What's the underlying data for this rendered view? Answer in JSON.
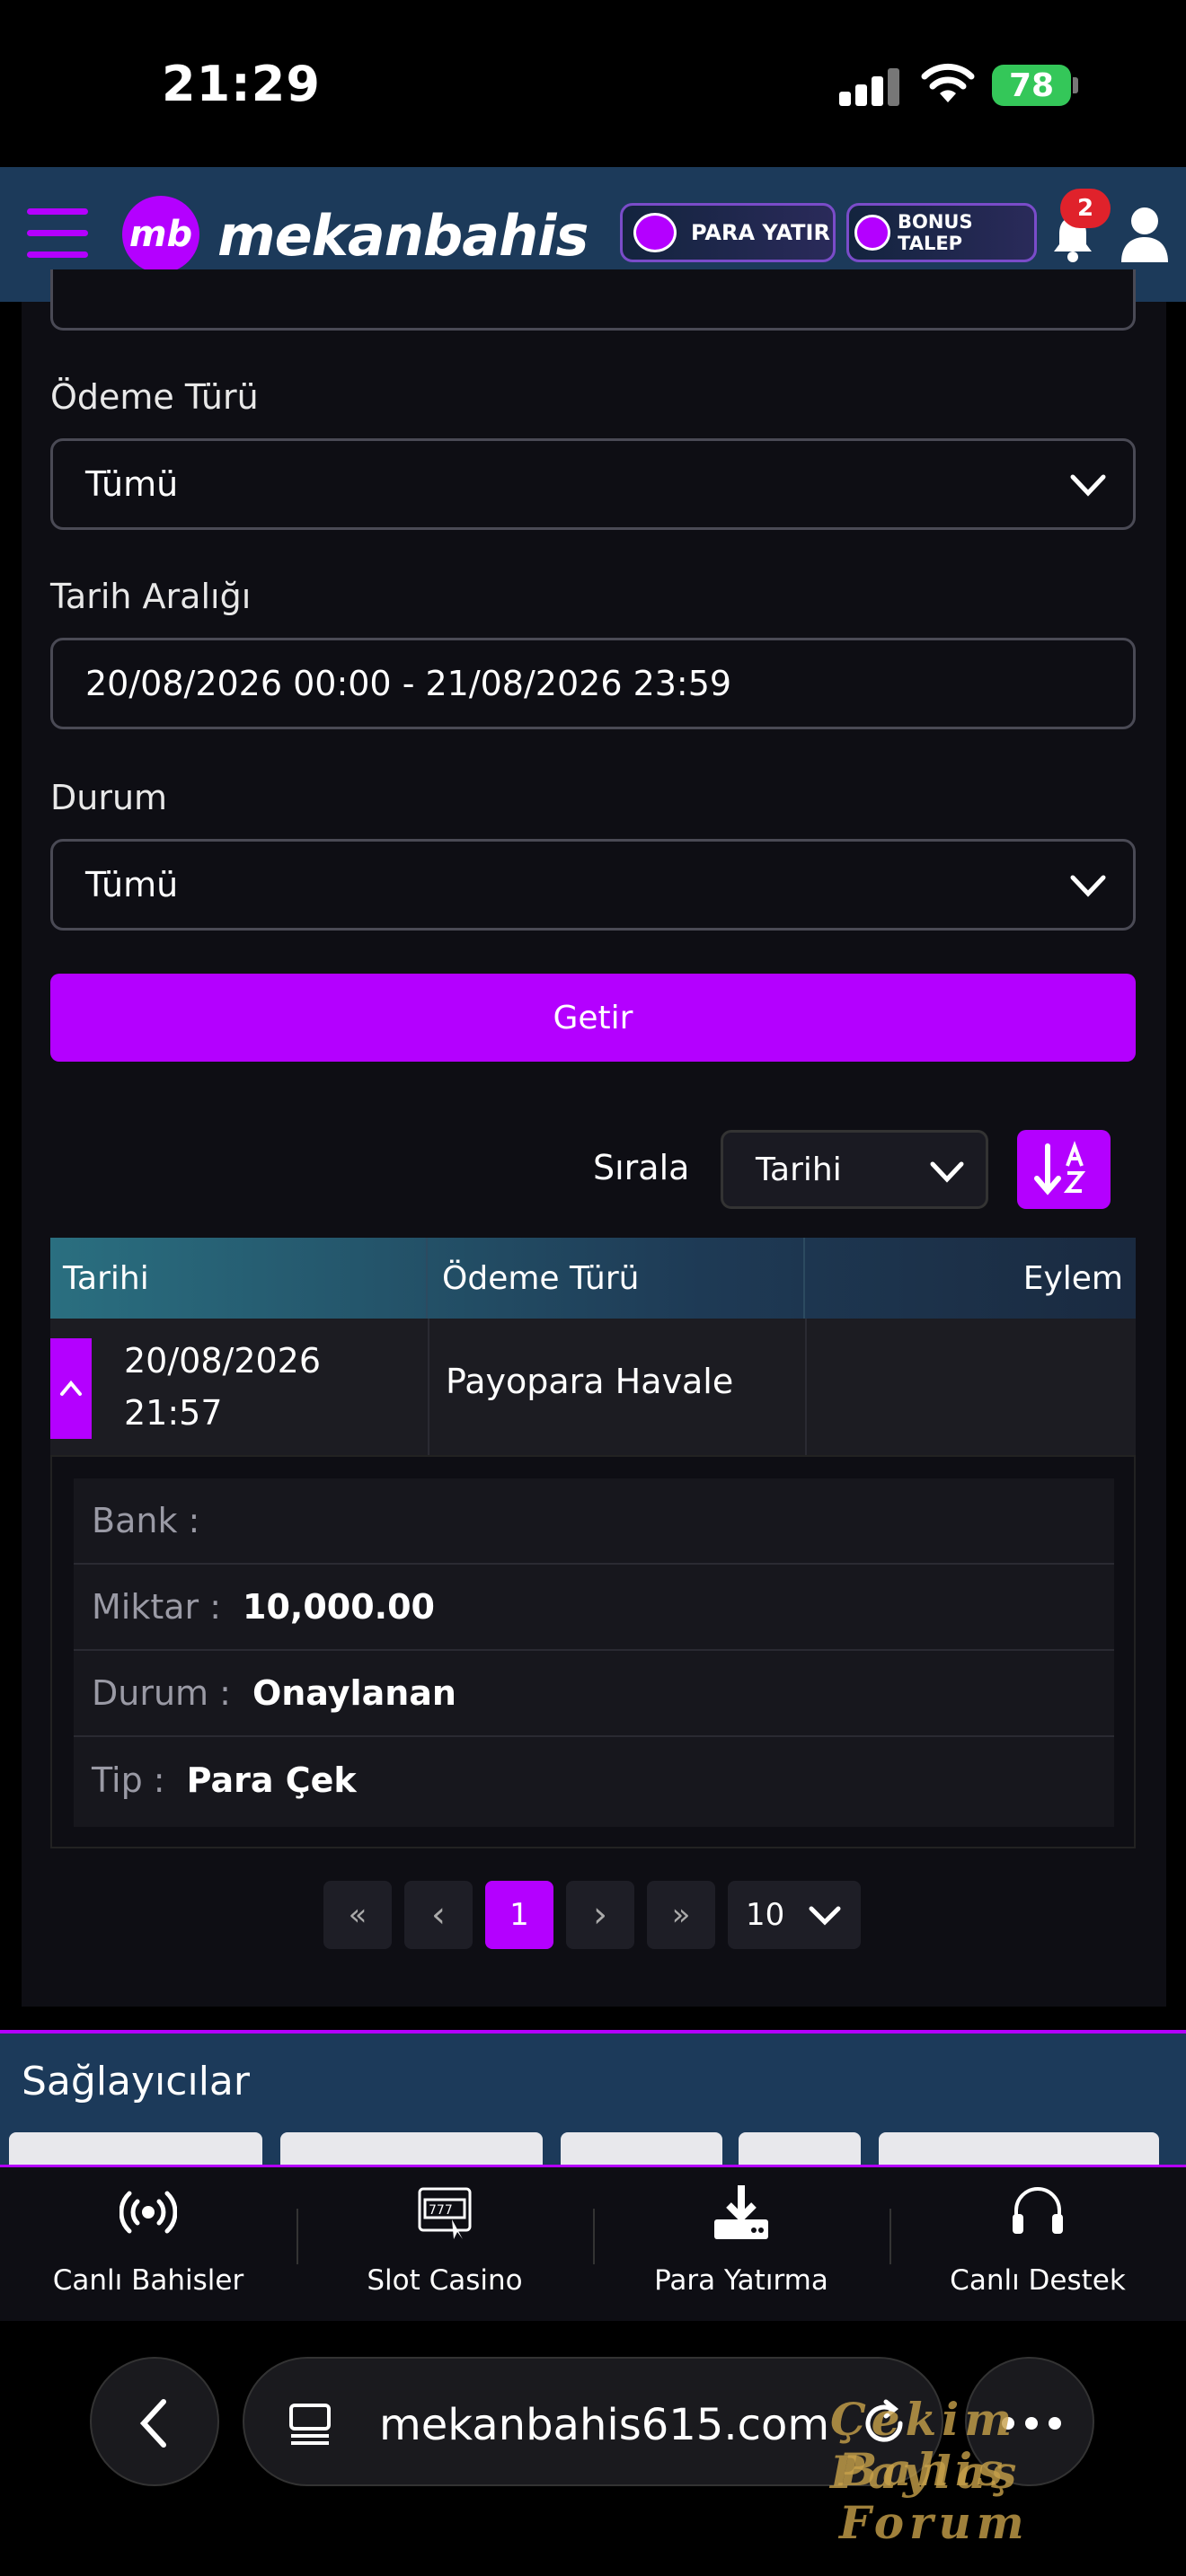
{
  "status_bar": {
    "time": "21:29",
    "battery": "78"
  },
  "header": {
    "logo_mark": "mb",
    "logo_text": "mekanbahis",
    "deposit_button": "PARA YATIR",
    "bonus_button": "BONUS TALEP",
    "notification_count": "2"
  },
  "filters": {
    "payment_type_label": "Ödeme Türü",
    "payment_type_value": "Tümü",
    "date_range_label": "Tarih Aralığı",
    "date_range_value": "20/08/2026 00:00 - 21/08/2026 23:59",
    "status_label": "Durum",
    "status_value": "Tümü",
    "fetch_button": "Getir"
  },
  "sort": {
    "label": "Sırala",
    "value": "Tarihi"
  },
  "table": {
    "columns": [
      "Tarihi",
      "Ödeme Türü",
      "Eylem"
    ],
    "rows": [
      {
        "date_line1": "20/08/2026",
        "date_line2": "21:57",
        "payment_type": "Payopara Havale",
        "details": [
          {
            "key": "Bank :",
            "value": ""
          },
          {
            "key": "Miktar :",
            "value": "10,000.00"
          },
          {
            "key": "Durum :",
            "value": "Onaylanan"
          },
          {
            "key": "Tip :",
            "value": "Para Çek"
          }
        ]
      }
    ]
  },
  "pagination": {
    "first": "«",
    "prev": "‹",
    "current": "1",
    "next": "›",
    "last": "»",
    "page_size": "10"
  },
  "providers": {
    "title": "Sağlayıcılar"
  },
  "bottom_nav": [
    {
      "label": "Canlı Bahisler",
      "icon": "live-broadcast-icon"
    },
    {
      "label": "Slot Casino",
      "icon": "slot-machine-icon"
    },
    {
      "label": "Para Yatırma",
      "icon": "download-icon"
    },
    {
      "label": "Canlı Destek",
      "icon": "headset-icon"
    }
  ],
  "browser": {
    "url": "mekanbahis615.com"
  },
  "watermark": {
    "line1": "Çekim Paylaş",
    "line2": "Bahis Forum"
  },
  "colors": {
    "accent": "#b400ff",
    "header_bg": "#1c3a5a",
    "panel_bg": "#0e0e14"
  }
}
